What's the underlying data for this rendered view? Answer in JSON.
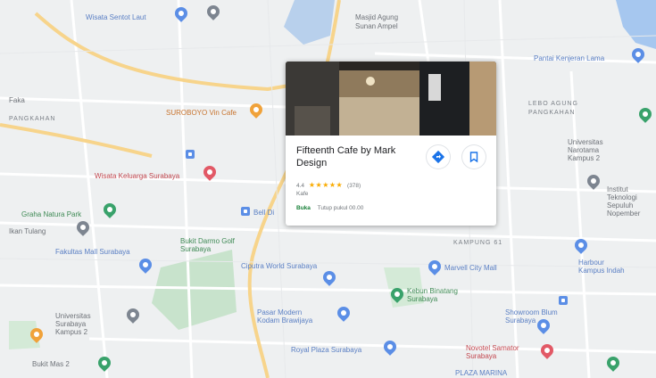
{
  "map": {
    "area_labels": [
      "PANGKAHAN",
      "LEBO AGUNG",
      "PANGKAHAN",
      "KAMPUNG 61"
    ],
    "places": [
      {
        "id": "wisata-sentot",
        "name": "Wisata Sentot Laut",
        "color": "blue",
        "icon": "pin-blue"
      },
      {
        "id": "masjid",
        "name": "Masjid Agung",
        "color": "gray",
        "icon": "pin-gray"
      },
      {
        "id": "masjid-2",
        "name": "Sunan Ampel",
        "color": "gray",
        "icon": ""
      },
      {
        "id": "pantai",
        "name": "Pantai Kenjeran Lama",
        "color": "blue",
        "icon": "pin-blue"
      },
      {
        "id": "suroboyo",
        "name": "SUROBOYO Vin Cafe",
        "color": "orange",
        "icon": "pin-orange"
      },
      {
        "id": "faka",
        "name": "Faka",
        "color": "gray",
        "icon": ""
      },
      {
        "id": "universitas",
        "name": "Universitas Narotama Kampus 2",
        "color": "gray",
        "icon": "pin-green"
      },
      {
        "id": "institut",
        "name": "Institut Teknologi Sepuluh Nopember",
        "color": "gray",
        "icon": "pin-gray"
      },
      {
        "id": "wisata-keluarga",
        "name": "Wisata Keluarga Surabaya",
        "color": "red",
        "icon": "pin-red"
      },
      {
        "id": "graha",
        "name": "Graha Natura Park",
        "color": "green",
        "icon": "pin-green"
      },
      {
        "id": "ikan-tulang",
        "name": "Ikan Tulang",
        "color": "gray",
        "icon": "pin-gray"
      },
      {
        "id": "fakultas",
        "name": "Fakultas Mall Surabaya",
        "color": "blue",
        "icon": "pin-blue"
      },
      {
        "id": "bukit-darmo",
        "name": "Bukit Darmo Golf Surabaya",
        "color": "green",
        "icon": ""
      },
      {
        "id": "ciputra",
        "name": "Ciputra World Surabaya",
        "color": "blue",
        "icon": ""
      },
      {
        "id": "marvell",
        "name": "Marvell City Mall",
        "color": "blue",
        "icon": "pin-blue"
      },
      {
        "id": "harbour",
        "name": "Harbour Kampus Indah",
        "color": "blue",
        "icon": "pin-blue"
      },
      {
        "id": "kebun-binatang",
        "name": "Kebun Binatang Surabaya",
        "color": "green",
        "icon": "pin-green"
      },
      {
        "id": "pasar",
        "name": "Pasar Modern Kodam Brawijaya",
        "color": "blue",
        "icon": "pin-blue"
      },
      {
        "id": "universitas-surabaya",
        "name": "Universitas Surabaya Kampus 2",
        "color": "gray",
        "icon": "pin-gray"
      },
      {
        "id": "showroom",
        "name": "Showroom Blum Surabaya",
        "color": "blue",
        "icon": "pin-blue"
      },
      {
        "id": "royal",
        "name": "Royal Plaza Surabaya",
        "color": "blue",
        "icon": "pin-blue"
      },
      {
        "id": "novotel",
        "name": "Novotel Samator Surabaya",
        "color": "red",
        "icon": "pin-red"
      },
      {
        "id": "bukit-mas",
        "name": "Bukit Mas 2",
        "color": "gray",
        "icon": "pin-green"
      },
      {
        "id": "plaza-marina",
        "name": "PLAZA MARINA",
        "color": "blue",
        "icon": ""
      },
      {
        "id": "jalan-sq",
        "name": "Bell Di",
        "color": "blue",
        "icon": "square-blue"
      }
    ],
    "card": {
      "title": "Fifteenth Cafe by Mark Design",
      "rating": "4.4",
      "stars": "★★★★★",
      "review_count": "(378)",
      "category": "Kafe",
      "status": "Buka",
      "hours": "Tutup pukul 00.00",
      "directions_icon": "directions-icon",
      "save_icon": "bookmark-icon"
    },
    "colors": {
      "water": "#a6c7ef",
      "park": "#c8e3cc",
      "major_road": "#f7d48b",
      "minor_road": "#ffffff",
      "land": "#eef0f1",
      "rating_star": "#f9ab00",
      "open_green": "#188038"
    }
  }
}
